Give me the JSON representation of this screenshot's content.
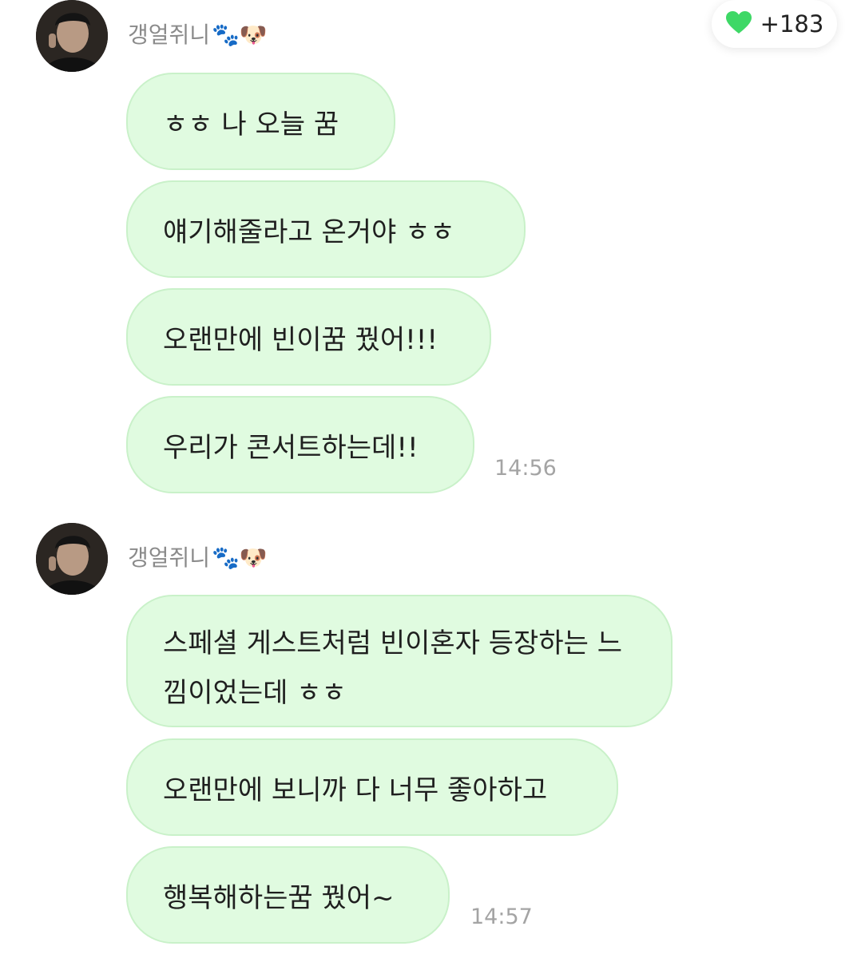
{
  "like_badge": {
    "icon": "heart-icon",
    "color": "#3ed866",
    "count": "+183"
  },
  "groups": [
    {
      "sender": "갱얼쥐니",
      "sender_emoji": "🐾🐶",
      "messages": [
        "ㅎㅎ 나 오늘 꿈",
        "얘기해줄라고 온거야 ㅎㅎ",
        "오랜만에 빈이꿈 꿨어!!!",
        "우리가 콘서트하는데!!"
      ],
      "time": "14:56"
    },
    {
      "sender": "갱얼쥐니",
      "sender_emoji": "🐾🐶",
      "messages": [
        "스페셜 게스트처럼 빈이혼자 등장하는 느낌이었는데 ㅎㅎ",
        "오랜만에 보니까 다 너무 좋아하고",
        "행복해하는꿈 꿨어~"
      ],
      "time": "14:57"
    }
  ],
  "colors": {
    "bubble_fill": "#e0fbe0",
    "bubble_border": "#c9f1c9",
    "timestamp": "#a4a4a4",
    "sender_name": "#8a8a8a"
  }
}
